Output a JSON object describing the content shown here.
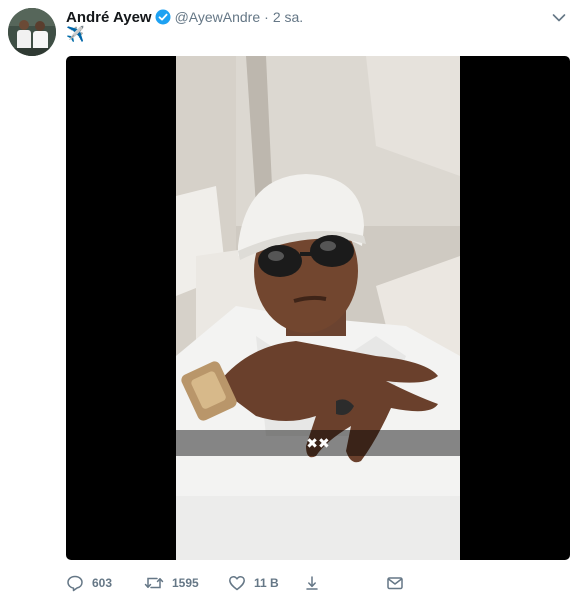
{
  "user": {
    "name": "André Ayew",
    "handle": "@AyewAndre",
    "separator": "·",
    "time": "2 sa.",
    "verified": true
  },
  "tweet": {
    "text": "✈️"
  },
  "media": {
    "caption": "✖✖"
  },
  "actions": {
    "replies": "603",
    "retweets": "1595",
    "likes": "11 B"
  },
  "colors": {
    "verified_blue": "#1da1f2",
    "muted": "#657786",
    "text": "#14171a"
  }
}
